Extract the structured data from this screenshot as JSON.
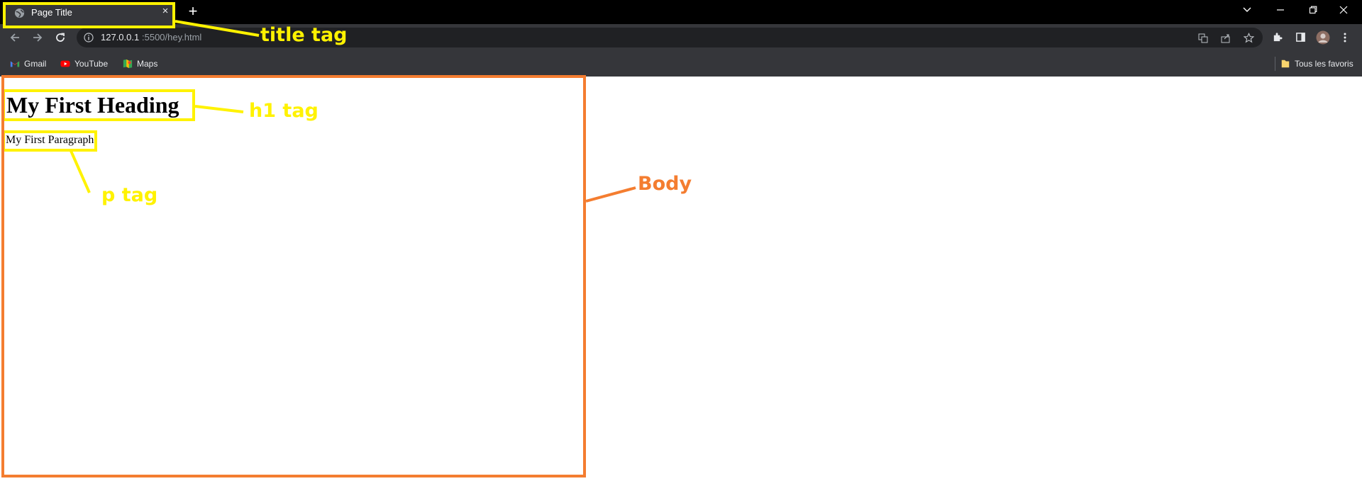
{
  "browser": {
    "tab_title": "Page Title",
    "tab_close": "×",
    "new_tab": "+",
    "url_host": "127.0.0.1",
    "url_path": ":5500/hey.html",
    "bookmarks": [
      {
        "label": "Gmail",
        "icon": "gmail-icon"
      },
      {
        "label": "YouTube",
        "icon": "youtube-icon"
      },
      {
        "label": "Maps",
        "icon": "maps-icon"
      }
    ],
    "all_bookmarks": "Tous les favoris"
  },
  "page": {
    "heading": "My First Heading",
    "paragraph": "My First Paragraph"
  },
  "annotations": {
    "title": "title tag",
    "h1": "h1 tag",
    "p": "p tag",
    "body": "Body"
  },
  "colors": {
    "highlight_yellow": "#fff200",
    "body_orange": "#f47d30",
    "chrome_dark": "#35363a",
    "tabstrip": "#000000"
  }
}
